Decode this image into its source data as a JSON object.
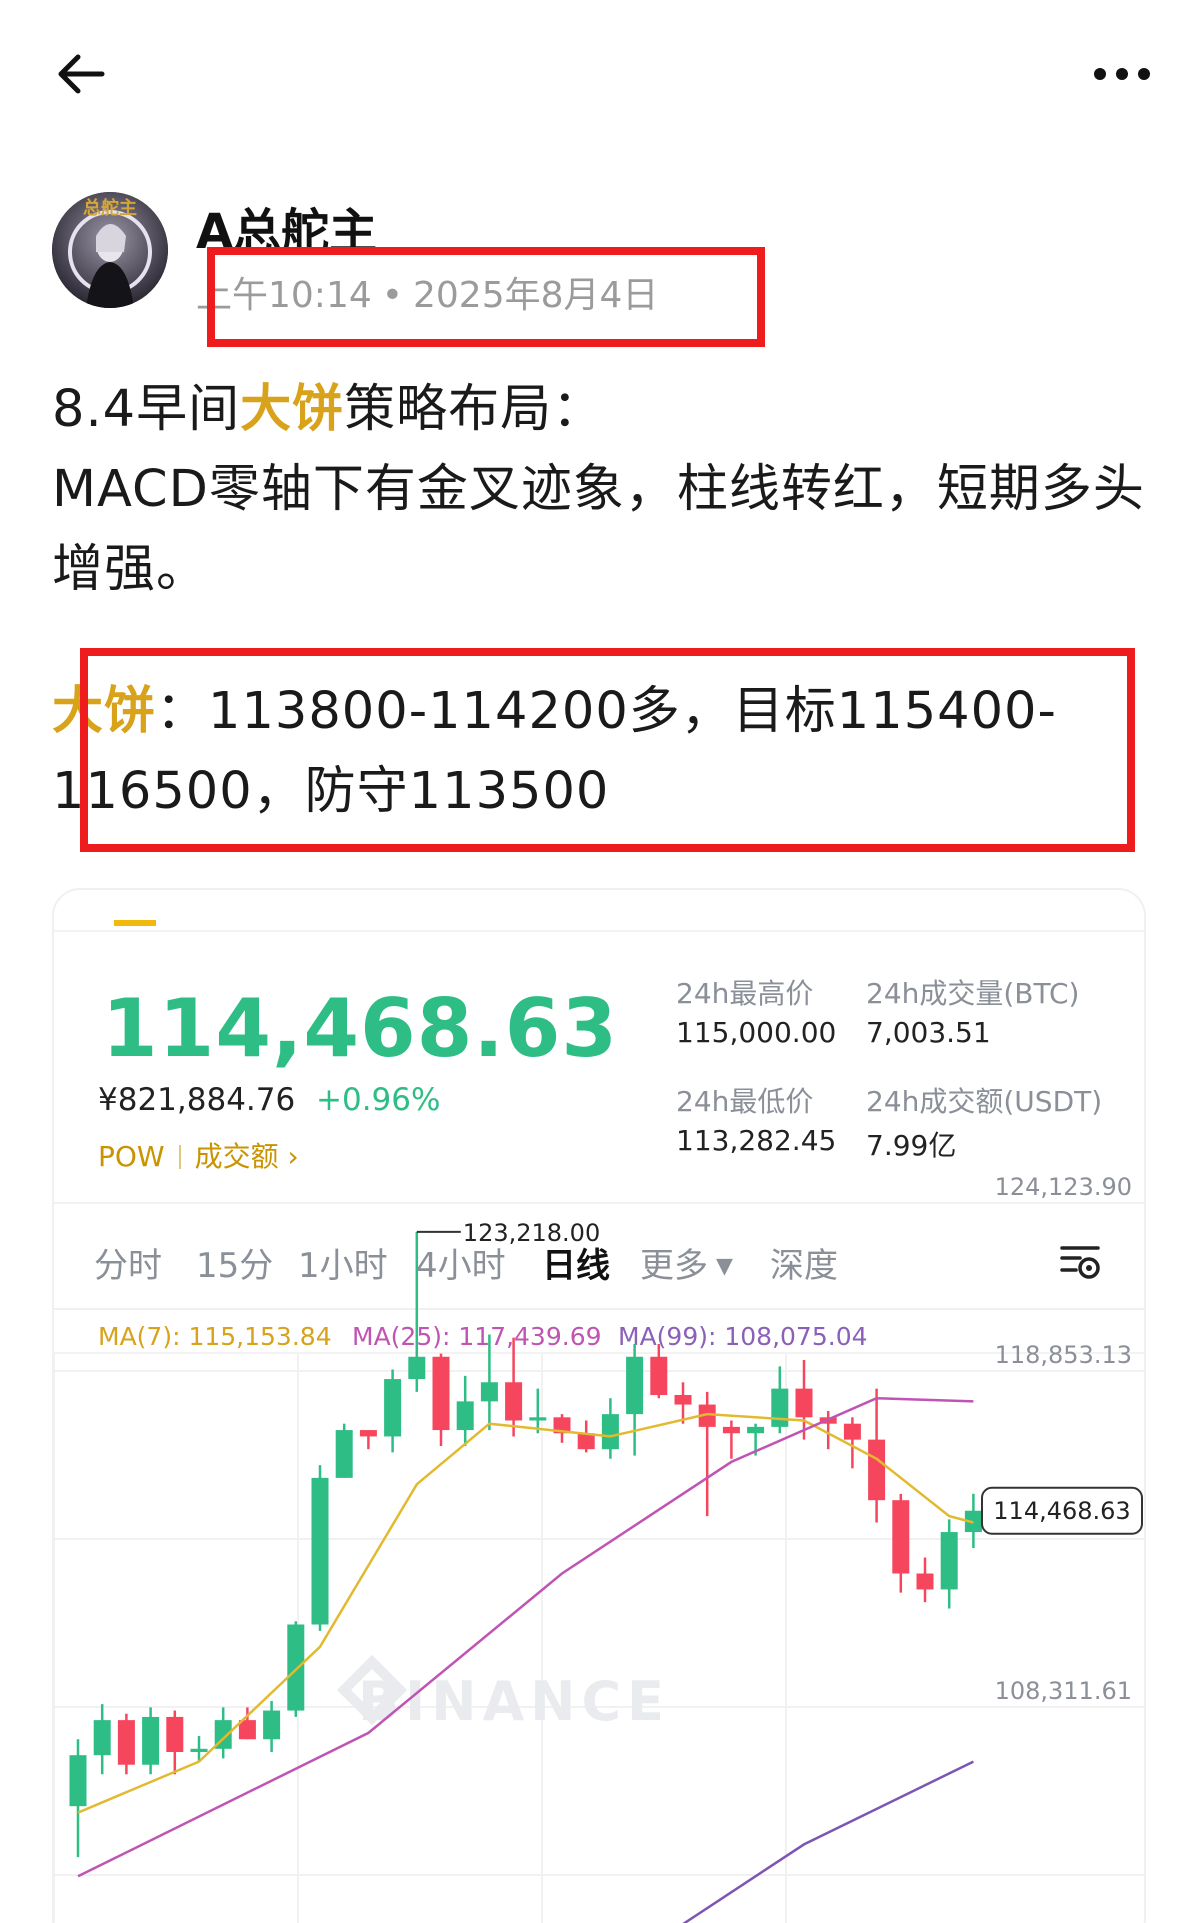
{
  "topbar": {
    "back_icon": "arrow-left-icon",
    "more_icon": "more-horizontal-icon"
  },
  "post": {
    "author": "A总舵主",
    "time": "上午10:14",
    "date": "2025年8月4日",
    "line1_prefix": "8.4早间",
    "line1_highlight": "大饼",
    "line1_suffix": "策略布局：",
    "line2": "MACD零轴下有金叉迹象，柱线转红，短期多头增强。",
    "strategy_highlight": "大饼",
    "strategy_text": "：113800-114200多，目标115400-116500，防守113500"
  },
  "market": {
    "price": "114,468.63",
    "cny": "¥821,884.76",
    "change": "+0.96%",
    "tag1": "POW",
    "tag2": "成交额",
    "high_label": "24h最高价",
    "high_value": "115,000.00",
    "vol_btc_label": "24h成交量(BTC)",
    "vol_btc_value": "7,003.51",
    "low_label": "24h最低价",
    "low_value": "113,282.45",
    "vol_usdt_label": "24h成交额(USDT)",
    "vol_usdt_value": "7.99亿",
    "colors": {
      "up": "#2ebd85",
      "down": "#f6465d",
      "brand": "#f0b90b"
    }
  },
  "timeframes": [
    "分时",
    "15分",
    "1小时",
    "4小时",
    "日线",
    "更多",
    "深度"
  ],
  "active_timeframe": "日线",
  "indicators": {
    "ma7": "MA(7): 115,153.84",
    "ma25": "MA(25): 117,439.69",
    "ma99": "MA(99): 108,075.04"
  },
  "chart_data": {
    "type": "candlestick",
    "y_ticks": [
      124123.9,
      118853.13,
      108311.61
    ],
    "y_tick_labels": [
      "124,123.90",
      "118,853.13",
      "108,311.61"
    ],
    "current_price_label": "114,468.63",
    "high_annotation": "123,218.00",
    "watermark": "BINANCE",
    "candles": [
      {
        "o": 105200,
        "h": 107300,
        "l": 103600,
        "c": 106800
      },
      {
        "o": 106800,
        "h": 108400,
        "l": 106200,
        "c": 107900
      },
      {
        "o": 107900,
        "h": 108100,
        "l": 106200,
        "c": 106500
      },
      {
        "o": 106500,
        "h": 108300,
        "l": 106200,
        "c": 108000
      },
      {
        "o": 108000,
        "h": 108200,
        "l": 106200,
        "c": 106900
      },
      {
        "o": 106900,
        "h": 107400,
        "l": 106600,
        "c": 107000
      },
      {
        "o": 107000,
        "h": 108300,
        "l": 106700,
        "c": 107900
      },
      {
        "o": 107900,
        "h": 108300,
        "l": 107300,
        "c": 107300
      },
      {
        "o": 107300,
        "h": 108500,
        "l": 106900,
        "c": 108200
      },
      {
        "o": 108200,
        "h": 111000,
        "l": 108000,
        "c": 110900
      },
      {
        "o": 110900,
        "h": 115900,
        "l": 110700,
        "c": 115500
      },
      {
        "o": 115500,
        "h": 117200,
        "l": 115500,
        "c": 117000
      },
      {
        "o": 117000,
        "h": 117000,
        "l": 116400,
        "c": 116800
      },
      {
        "o": 116800,
        "h": 118900,
        "l": 116300,
        "c": 118600
      },
      {
        "o": 118600,
        "h": 123218,
        "l": 118200,
        "c": 119300
      },
      {
        "o": 119300,
        "h": 119400,
        "l": 116500,
        "c": 117000
      },
      {
        "o": 117000,
        "h": 118700,
        "l": 116500,
        "c": 117900
      },
      {
        "o": 117900,
        "h": 120000,
        "l": 117000,
        "c": 118500
      },
      {
        "o": 118500,
        "h": 119900,
        "l": 116800,
        "c": 117300
      },
      {
        "o": 117300,
        "h": 118300,
        "l": 116900,
        "c": 117400
      },
      {
        "o": 117400,
        "h": 117500,
        "l": 116600,
        "c": 116900
      },
      {
        "o": 116900,
        "h": 117300,
        "l": 116300,
        "c": 116400
      },
      {
        "o": 116400,
        "h": 118000,
        "l": 116100,
        "c": 117500
      },
      {
        "o": 117500,
        "h": 119700,
        "l": 116200,
        "c": 119300
      },
      {
        "o": 119300,
        "h": 119700,
        "l": 118000,
        "c": 118100
      },
      {
        "o": 118100,
        "h": 118500,
        "l": 117200,
        "c": 117800
      },
      {
        "o": 117800,
        "h": 118200,
        "l": 114300,
        "c": 117100
      },
      {
        "o": 117100,
        "h": 117300,
        "l": 116100,
        "c": 116900
      },
      {
        "o": 116900,
        "h": 117200,
        "l": 116200,
        "c": 117100
      },
      {
        "o": 117100,
        "h": 119000,
        "l": 116900,
        "c": 118300
      },
      {
        "o": 118300,
        "h": 119200,
        "l": 116700,
        "c": 117400
      },
      {
        "o": 117400,
        "h": 117600,
        "l": 116400,
        "c": 117200
      },
      {
        "o": 117200,
        "h": 117400,
        "l": 115800,
        "c": 116700
      },
      {
        "o": 116700,
        "h": 118300,
        "l": 114100,
        "c": 114800
      },
      {
        "o": 114800,
        "h": 115000,
        "l": 111900,
        "c": 112500
      },
      {
        "o": 112500,
        "h": 113000,
        "l": 111600,
        "c": 112000
      },
      {
        "o": 112000,
        "h": 114200,
        "l": 111400,
        "c": 113800
      },
      {
        "o": 113800,
        "h": 115000,
        "l": 113300,
        "c": 114468.63
      }
    ],
    "ma7": [
      [
        0,
        105000
      ],
      [
        5,
        106600
      ],
      [
        10,
        110200
      ],
      [
        14,
        115300
      ],
      [
        17,
        117200
      ],
      [
        22,
        116800
      ],
      [
        26,
        117500
      ],
      [
        30,
        117300
      ],
      [
        33,
        116100
      ],
      [
        36,
        114300
      ],
      [
        37,
        114100
      ]
    ],
    "ma25": [
      [
        0,
        103000
      ],
      [
        12,
        107500
      ],
      [
        20,
        112500
      ],
      [
        27,
        116000
      ],
      [
        33,
        118000
      ],
      [
        37,
        117900
      ]
    ],
    "ma99": [
      [
        24,
        101000
      ],
      [
        30,
        104000
      ],
      [
        37,
        106600
      ]
    ]
  }
}
